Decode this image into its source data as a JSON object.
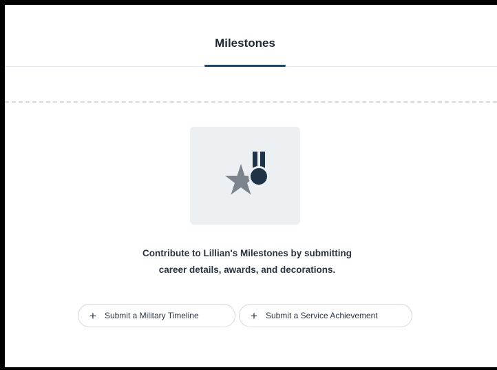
{
  "tabs": {
    "active_label": "Milestones"
  },
  "empty_state": {
    "icon": "medal-star-icon",
    "line1": "Contribute to Lillian's Milestones by submitting",
    "line2": "career details, awards, and decorations."
  },
  "actions": {
    "timeline_label": "Submit a Military Timeline",
    "achievement_label": "Submit a Service Achievement",
    "plus_glyph": "+"
  },
  "colors": {
    "accent": "#1e4466",
    "icon_star": "#7b838c",
    "icon_medal": "#1f3347",
    "illustration_bg": "#edf0f3"
  }
}
